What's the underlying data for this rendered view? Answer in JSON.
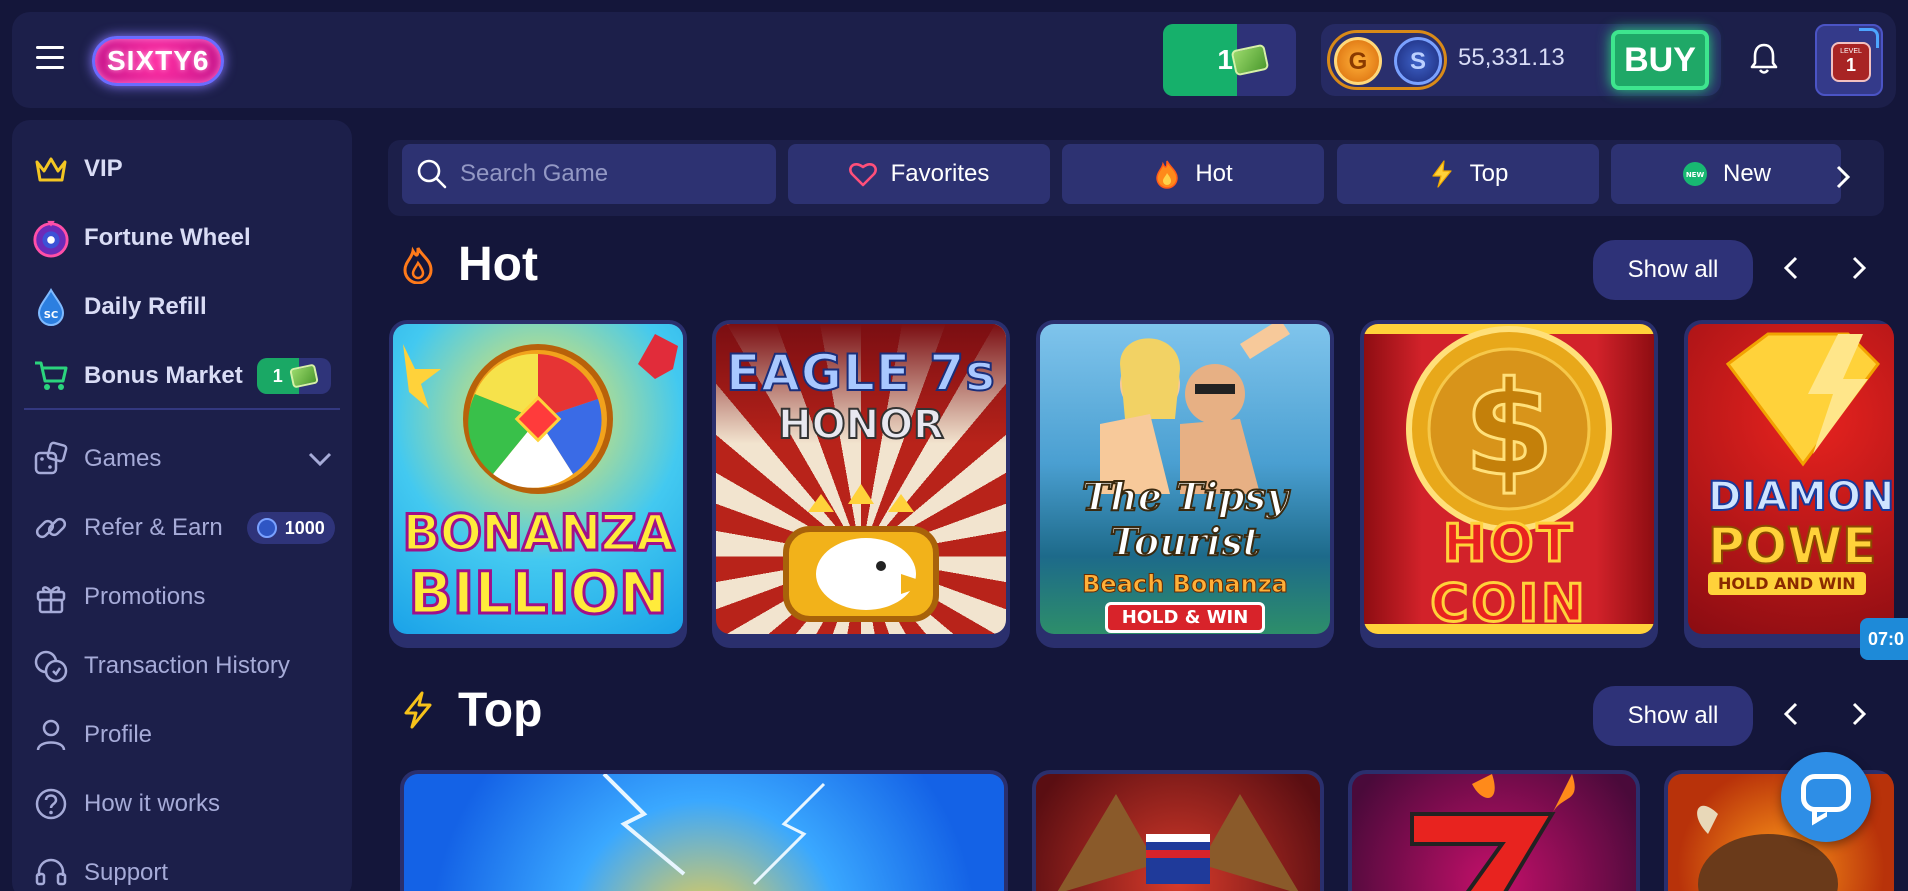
{
  "header": {
    "logo": "SIXTY6",
    "tickets_count": "1",
    "coin_g": "G",
    "coin_s": "S",
    "balance": "55,331.13",
    "buy_label": "BUY",
    "avatar_level_label": "LEVEL",
    "avatar_level": "1"
  },
  "sidebar": {
    "items": [
      {
        "label": "VIP",
        "icon": "crown-icon"
      },
      {
        "label": "Fortune Wheel",
        "icon": "wheel-icon"
      },
      {
        "label": "Daily Refill",
        "icon": "drop-icon",
        "icon_text": "SC"
      },
      {
        "label": "Bonus Market",
        "icon": "cart-icon",
        "badge": "1"
      },
      {
        "label": "Games",
        "icon": "dice-icon"
      },
      {
        "label": "Refer & Earn",
        "icon": "link-icon",
        "badge": "1000"
      },
      {
        "label": "Promotions",
        "icon": "gift-icon"
      },
      {
        "label": "Transaction History",
        "icon": "coins-icon"
      },
      {
        "label": "Profile",
        "icon": "user-icon"
      },
      {
        "label": "How it works",
        "icon": "question-icon"
      },
      {
        "label": "Support",
        "icon": "headset-icon"
      }
    ]
  },
  "filters": {
    "search_placeholder": "Search Game",
    "tabs": [
      "Favorites",
      "Hot",
      "Top",
      "New"
    ],
    "new_icon_text": "NEW"
  },
  "sections": {
    "hot": {
      "title": "Hot",
      "show_all": "Show all",
      "games": [
        {
          "name_line1": "BONANZA",
          "name_line2": "BILLION"
        },
        {
          "name_line1": "EAGLE 7s",
          "name_line2": "HONOR"
        },
        {
          "name_line1": "The Tipsy Tourist",
          "name_line2": "Beach Bonanza",
          "tag": "HOLD & WIN"
        },
        {
          "name_line1": "HOT",
          "name_line2": "COIN"
        },
        {
          "name_line1": "DIAMON",
          "name_line2": "POWE",
          "tag": "HOLD AND WIN"
        }
      ]
    },
    "top": {
      "title": "Top",
      "show_all": "Show all"
    }
  },
  "timer": "07:0",
  "colors": {
    "background": "#14163a",
    "panel": "#1c1f4a",
    "accent_green": "#1fa867",
    "accent_blue": "#2e8ee6"
  }
}
